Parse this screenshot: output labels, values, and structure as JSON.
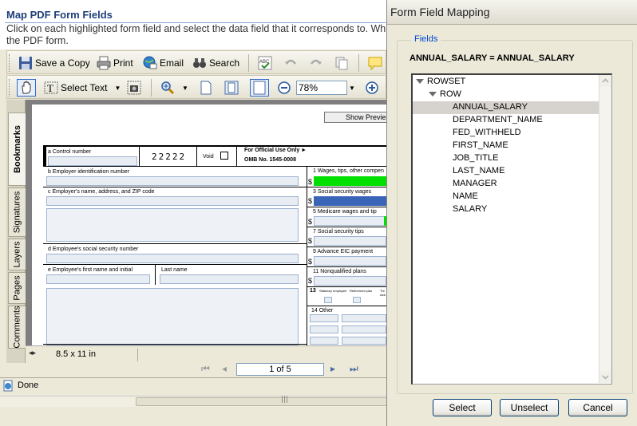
{
  "main": {
    "title": "Map PDF Form Fields",
    "description": "Click on each highlighted form field and select the data field that it corresponds to. Wh\nthe PDF form.",
    "toolbar1": {
      "save_copy": "Save a Copy",
      "print": "Print",
      "email": "Email",
      "search": "Search"
    },
    "toolbar2": {
      "select_text": "Select Text",
      "zoom": "78%"
    },
    "nav_tabs": [
      "Bookmarks",
      "Signatures",
      "Layers",
      "Pages",
      "Comments"
    ],
    "show_preview": "Show Previe",
    "page_size": "8.5 x 11 in",
    "page_info": "1 of 5",
    "status": "Done",
    "form": {
      "a_label": "a  Control number",
      "code": "22222",
      "void": "Void",
      "official_1": "For Official Use Only ►",
      "official_2": "OMB No. 1545-0008",
      "b_label": "b  Employer identification number",
      "c_label": "c  Employer's name, address, and ZIP code",
      "d_label": "d  Employee's social security number",
      "e_label": "e  Employee's first name and initial",
      "last_name": "Last name",
      "box1": "1   Wages, tips, other compen",
      "box3": "3   Social security wages",
      "box5": "5   Medicare wages and tip",
      "box7": "7   Social security tips",
      "box9": "9   Advance EIC payment",
      "box11": "11   Nonqualified plans",
      "box13": "13",
      "box13a": "Statutory employee",
      "box13b": "Retirement plan",
      "box13c": "Thi sick",
      "box14": "14   Other",
      "dollar": "$"
    }
  },
  "dialog": {
    "title": "Form Field Mapping",
    "legend": "Fields",
    "mapping": "ANNUAL_SALARY = ANNUAL_SALARY",
    "tree": {
      "root": "ROWSET",
      "child": "ROW",
      "fields": [
        "ANNUAL_SALARY",
        "DEPARTMENT_NAME",
        "FED_WITHHELD",
        "FIRST_NAME",
        "JOB_TITLE",
        "LAST_NAME",
        "MANAGER",
        "NAME",
        "SALARY"
      ]
    },
    "buttons": {
      "select": "Select",
      "unselect": "Unselect",
      "cancel": "Cancel"
    }
  },
  "colors": {
    "title_blue": "#1f3f7a",
    "legend_blue": "#0046d5",
    "highlight_green": "#00e000",
    "highlight_blue": "#3a64b8",
    "selected_row": "#d6d3ce"
  }
}
